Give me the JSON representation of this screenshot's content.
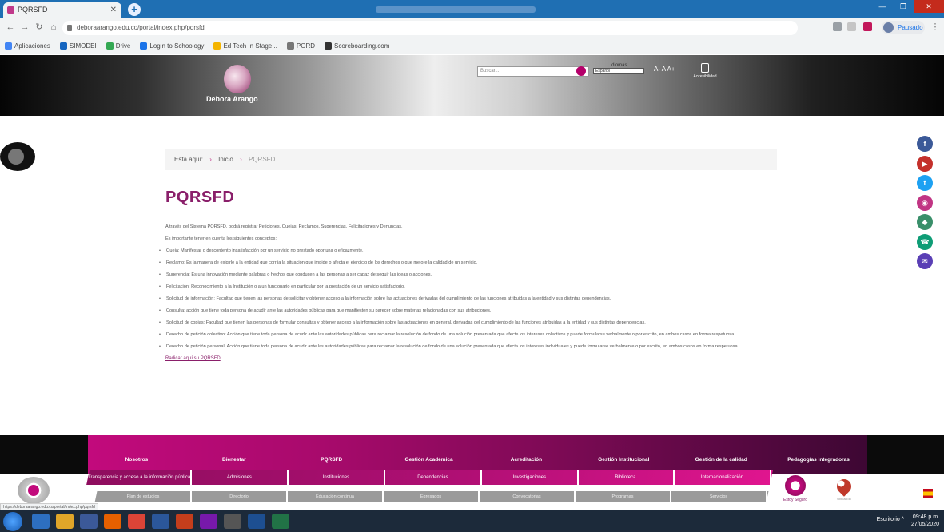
{
  "browser": {
    "tab_title": "PQRSFD",
    "url": "deboraarango.edu.co/portal/index.php/pqrsfd",
    "profile_label": "Pausado",
    "bookmarks": [
      "Aplicaciones",
      "SIMODEI",
      "Drive",
      "Login to Schoology",
      "Ed Tech In Stage...",
      "PORD",
      "Scoreboarding.com"
    ]
  },
  "header": {
    "logo_text": "Debora Arango",
    "search_placeholder": "Buscar...",
    "language_label": "Idiomas",
    "language_selected": "Español",
    "font_controls": "A- A A+",
    "accessibility_label": "Accesibilidad"
  },
  "breadcrumb": {
    "prefix": "Está aquí:",
    "home": "Inicio",
    "current": "PQRSFD"
  },
  "page": {
    "title": "PQRSFD",
    "intro": "A través del Sistema PQRSFD, podrá registrar Peticiones, Quejas, Reclamos, Sugerencias, Felicitaciones y Denuncias.",
    "note": "Es importante tener en cuenta los siguientes conceptos:",
    "items": [
      "Queja: Manifestar o descontento insatisfacción por un servicio no prestado oportuna o eficazmente.",
      "Reclamo: Es la manera de exigirle a la entidad que corrija la situación que impide o afecta el ejercicio de los derechos o que mejore la calidad de un servicio.",
      "Sugerencia: Es una innovación mediante palabras o hechos que conducen a las personas a ser capaz de seguir las ideas o acciones.",
      "Felicitación: Reconocimiento a la Institución o a un funcionario en particular por la prestación de un servicio satisfactorio.",
      "Solicitud de información: Facultad que tienen las personas de solicitar y obtener acceso a la información sobre las actuaciones derivadas del cumplimiento de las funciones atribuidas a la entidad y sus distintas dependencias.",
      "Consulta: acción que tiene toda persona de acudir ante las autoridades públicas para que manifiesten su parecer sobre materias relacionadas con sus atribuciones.",
      "Solicitud de copias: Facultad que tienen las personas de formular consultas y obtener acceso a la información sobre las actuaciones en general, derivadas del cumplimiento de las funciones atribuidas a la entidad y sus distintas dependencias.",
      "Derecho de petición colectivo: Acción que tiene toda persona de acudir ante las autoridades públicas para reclamar la resolución de fondo de una solución presentada que afecte los intereses colectivos y puede formularse verbalmente o por escrito, en ambos casos en forma respetuosa.",
      "Derecho de petición personal: Acción que tiene toda persona de acudir ante las autoridades públicas para reclamar la resolución de fondo de una solución presentada que afecta los intereses individuales y puede formularse verbalmente o por escrito, en ambos casos en forma respetuosa."
    ],
    "link": "Radicar aquí su PQRSFD"
  },
  "social": [
    {
      "name": "facebook",
      "glyph": "f",
      "color": "#3b5998"
    },
    {
      "name": "youtube",
      "glyph": "▶",
      "color": "#c4302b"
    },
    {
      "name": "twitter",
      "glyph": "t",
      "color": "#1da1f2"
    },
    {
      "name": "instagram",
      "glyph": "◉",
      "color": "#c13584"
    },
    {
      "name": "app",
      "glyph": "◆",
      "color": "#3a8f6a"
    },
    {
      "name": "whatsapp",
      "glyph": "☎",
      "color": "#0f9d76"
    },
    {
      "name": "chat",
      "glyph": "✉",
      "color": "#5a3fb5"
    }
  ],
  "footer": {
    "main_menu": [
      "Nosotros",
      "Bienestar",
      "PQRSFD",
      "Gestión Académica",
      "Acreditación",
      "Gestión Institucional",
      "Gestión de la calidad",
      "Pedagogías integradoras"
    ],
    "sub_menu_1": [
      "Transparencia y acceso a la información pública",
      "Admisiones",
      "Instituciones",
      "Dependencias",
      "Investigaciones",
      "Biblioteca",
      "Internacionalización"
    ],
    "sub_menu_2": [
      "Plan de estudios",
      "Directorio",
      "Educación continua",
      "Egresados",
      "Convocatorias",
      "Programas",
      "Servicios"
    ],
    "badge_label": "Estoy Seguro",
    "map_label": "Ubicación"
  },
  "status_url": "https://deboraarango.edu.co/portal/index.php/pqrsfd",
  "taskbar": {
    "tray": "Escritorio  ^",
    "time": "09:48 p.m.",
    "date": "27/05/2020"
  },
  "colors": {
    "brand": "#8a1f6a",
    "accent": "#c20a7c"
  }
}
